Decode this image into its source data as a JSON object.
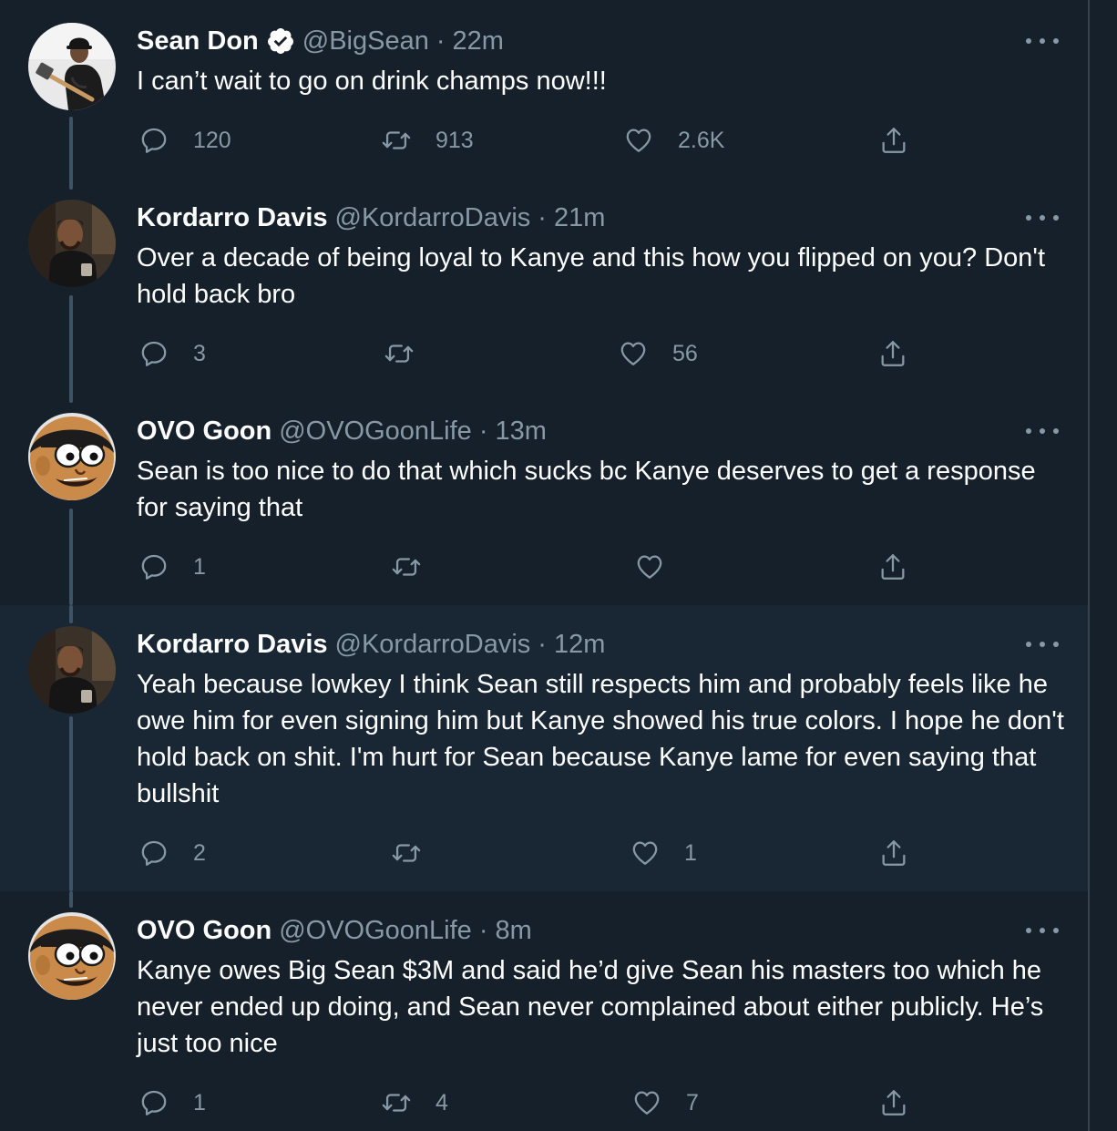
{
  "tweets": [
    {
      "name": "Sean Don",
      "verified": true,
      "handle": "@BigSean",
      "sep": "·",
      "time": "22m",
      "text": "I can’t wait to go on drink champs now!!!",
      "reply_count": "120",
      "retweet_count": "913",
      "like_count": "2.6K",
      "share_count": ""
    },
    {
      "name": "Kordarro Davis",
      "verified": false,
      "handle": "@KordarroDavis",
      "sep": "·",
      "time": "21m",
      "text": "Over a decade of being loyal to Kanye and this how you flipped on you? Don't hold back bro",
      "reply_count": "3",
      "retweet_count": "",
      "like_count": "56",
      "share_count": ""
    },
    {
      "name": "OVO Goon",
      "verified": false,
      "handle": "@OVOGoonLife",
      "sep": "·",
      "time": "13m",
      "text": "Sean is too nice to do that which sucks bc Kanye deserves to get a response for saying that",
      "reply_count": "1",
      "retweet_count": "",
      "like_count": "",
      "share_count": ""
    },
    {
      "name": "Kordarro Davis",
      "verified": false,
      "handle": "@KordarroDavis",
      "sep": "·",
      "time": "12m",
      "text": "Yeah because lowkey I think Sean still respects him and probably feels like he owe him for even signing him but Kanye showed his true colors. I hope he don't hold back on shit. I'm hurt for Sean because Kanye lame for even saying that bullshit",
      "reply_count": "2",
      "retweet_count": "",
      "like_count": "1",
      "share_count": ""
    },
    {
      "name": "OVO Goon",
      "verified": false,
      "handle": "@OVOGoonLife",
      "sep": "·",
      "time": "8m",
      "text": "Kanye owes Big Sean $3M and said he’d give Sean his masters too which he never ended up doing, and Sean never complained about either publicly. He’s just too nice",
      "reply_count": "1",
      "retweet_count": "4",
      "like_count": "7",
      "share_count": ""
    }
  ],
  "colors": {
    "background": "#15202b",
    "highlight_background": "#192734",
    "text_primary": "#ffffff",
    "text_secondary": "#8899a6",
    "thread_line": "#3d5466",
    "verified_badge": "#ffffff"
  },
  "icons": {
    "avatar_1": "profile-photo-man-with-hammer",
    "avatar_2": "profile-photo-man-in-dark-hoodie",
    "avatar_3": "cartoon-boy-face",
    "verified": "verified-badge-icon",
    "more": "more-options-icon",
    "reply": "reply-icon",
    "retweet": "retweet-icon",
    "like": "like-heart-icon",
    "share": "share-icon"
  }
}
